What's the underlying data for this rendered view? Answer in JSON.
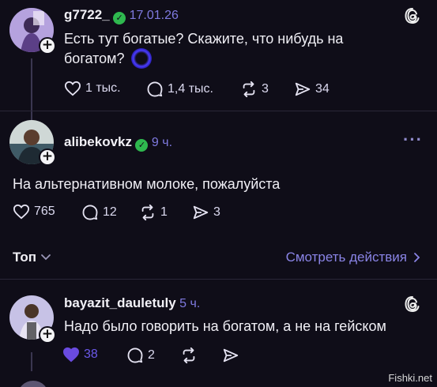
{
  "posts": [
    {
      "username": "g7722_",
      "time": "17.01.26",
      "text_line1": "Есть тут богатые? Скажите, что нибудь на",
      "text_line2": "богатом?",
      "likes": "1 тыс.",
      "replies": "1,4 тыс.",
      "reposts": "3",
      "shares": "34"
    },
    {
      "username": "alibekovkz",
      "time": "9 ч.",
      "text": "На альтернативном молоке, пожалуйста",
      "likes": "765",
      "replies": "12",
      "reposts": "1",
      "shares": "3"
    },
    {
      "username": "bayazit_dauletuly",
      "time": "5 ч.",
      "text": "Надо было говорить на богатом, а не на гейском",
      "likes": "38",
      "replies": "2",
      "reposts": "",
      "shares": ""
    }
  ],
  "sort": {
    "label": "Топ",
    "view_actions": "Смотреть действия"
  },
  "watermark": "Fishki.net",
  "colors": {
    "background": "#0f0d18",
    "accent": "#7f7ae0",
    "verified": "#2fb84f",
    "liked": "#6a4be0"
  }
}
